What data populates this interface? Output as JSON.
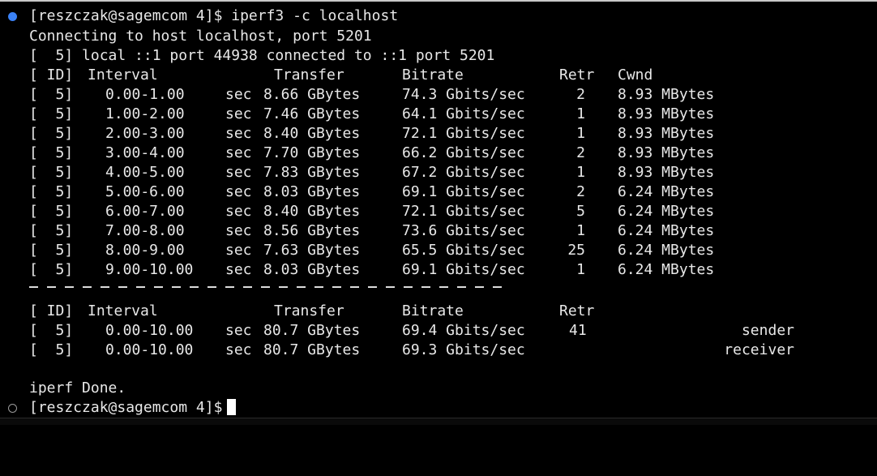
{
  "terminal": {
    "prompt_top": "[reszczak@sagemcom 4]$ iperf3 -c localhost",
    "connecting": "Connecting to host localhost, port 5201",
    "connected": "[  5] local ::1 port 44938 connected to ::1 port 5201",
    "header": {
      "id": "[ ID]",
      "interval": "Interval",
      "transfer": "Transfer",
      "bitrate": "Bitrate",
      "retr": "Retr",
      "cwnd": "Cwnd"
    },
    "rows": [
      {
        "id": "[  5]",
        "interval": "0.00-1.00",
        "unit": "sec",
        "transfer": "8.66 GBytes",
        "bitrate": "74.3 Gbits/sec",
        "retr": "2",
        "cwnd": "8.93 MBytes"
      },
      {
        "id": "[  5]",
        "interval": "1.00-2.00",
        "unit": "sec",
        "transfer": "7.46 GBytes",
        "bitrate": "64.1 Gbits/sec",
        "retr": "1",
        "cwnd": "8.93 MBytes"
      },
      {
        "id": "[  5]",
        "interval": "2.00-3.00",
        "unit": "sec",
        "transfer": "8.40 GBytes",
        "bitrate": "72.1 Gbits/sec",
        "retr": "1",
        "cwnd": "8.93 MBytes"
      },
      {
        "id": "[  5]",
        "interval": "3.00-4.00",
        "unit": "sec",
        "transfer": "7.70 GBytes",
        "bitrate": "66.2 Gbits/sec",
        "retr": "2",
        "cwnd": "8.93 MBytes"
      },
      {
        "id": "[  5]",
        "interval": "4.00-5.00",
        "unit": "sec",
        "transfer": "7.83 GBytes",
        "bitrate": "67.2 Gbits/sec",
        "retr": "1",
        "cwnd": "8.93 MBytes"
      },
      {
        "id": "[  5]",
        "interval": "5.00-6.00",
        "unit": "sec",
        "transfer": "8.03 GBytes",
        "bitrate": "69.1 Gbits/sec",
        "retr": "2",
        "cwnd": "6.24 MBytes"
      },
      {
        "id": "[  5]",
        "interval": "6.00-7.00",
        "unit": "sec",
        "transfer": "8.40 GBytes",
        "bitrate": "72.1 Gbits/sec",
        "retr": "5",
        "cwnd": "6.24 MBytes"
      },
      {
        "id": "[  5]",
        "interval": "7.00-8.00",
        "unit": "sec",
        "transfer": "8.56 GBytes",
        "bitrate": "73.6 Gbits/sec",
        "retr": "1",
        "cwnd": "6.24 MBytes"
      },
      {
        "id": "[  5]",
        "interval": "8.00-9.00",
        "unit": "sec",
        "transfer": "7.63 GBytes",
        "bitrate": "65.5 Gbits/sec",
        "retr": "25",
        "cwnd": "6.24 MBytes"
      },
      {
        "id": "[  5]",
        "interval": "9.00-10.00",
        "unit": "sec",
        "transfer": "8.03 GBytes",
        "bitrate": "69.1 Gbits/sec",
        "retr": "1",
        "cwnd": "6.24 MBytes"
      }
    ],
    "summary_header": {
      "id": "[ ID]",
      "interval": "Interval",
      "transfer": "Transfer",
      "bitrate": "Bitrate",
      "retr": "Retr"
    },
    "summary_rows": [
      {
        "id": "[  5]",
        "interval": "0.00-10.00",
        "unit": "sec",
        "transfer": "80.7 GBytes",
        "bitrate": "69.4 Gbits/sec",
        "retr": "41",
        "role": "sender"
      },
      {
        "id": "[  5]",
        "interval": "0.00-10.00",
        "unit": "sec",
        "transfer": "80.7 GBytes",
        "bitrate": "69.3 Gbits/sec",
        "retr": "",
        "role": "receiver"
      }
    ],
    "done": "iperf Done.",
    "prompt_bottom": "[reszczak@sagemcom 4]$"
  },
  "colors": {
    "background": "#000000",
    "text": "#e8e8e8",
    "active_dot": "#3b82f6",
    "inactive_dot": "#9a9a9a"
  }
}
